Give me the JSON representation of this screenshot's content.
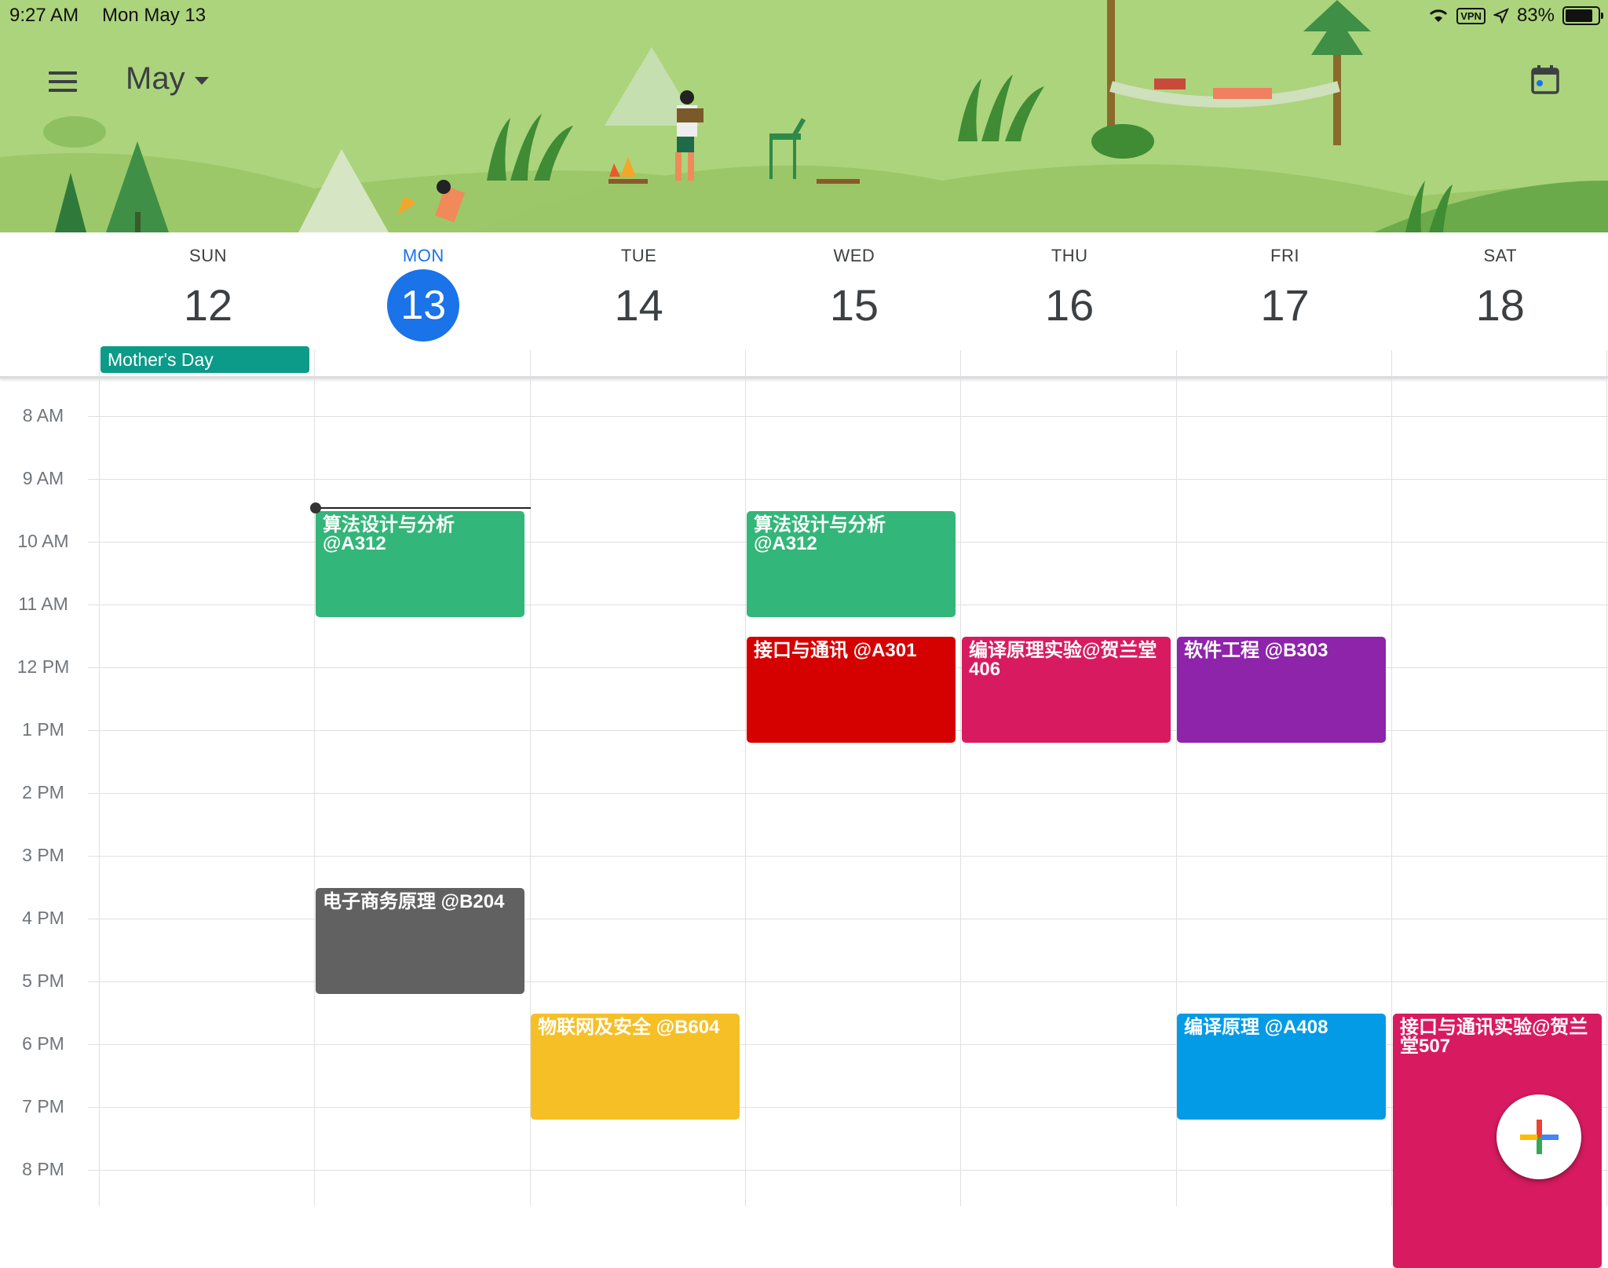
{
  "status_bar": {
    "time": "9:27 AM",
    "date": "Mon May 13",
    "vpn": "VPN",
    "battery": "83%",
    "icons": [
      "wifi-icon",
      "location-arrow-icon",
      "battery-icon"
    ]
  },
  "header": {
    "month": "May",
    "menu_icon": "hamburger-menu-icon",
    "today_icon": "calendar-today-icon"
  },
  "days": [
    {
      "name": "SUN",
      "date": "12",
      "today": false
    },
    {
      "name": "MON",
      "date": "13",
      "today": true
    },
    {
      "name": "TUE",
      "date": "14",
      "today": false
    },
    {
      "name": "WED",
      "date": "15",
      "today": false
    },
    {
      "name": "THU",
      "date": "16",
      "today": false
    },
    {
      "name": "FRI",
      "date": "17",
      "today": false
    },
    {
      "name": "SAT",
      "date": "18",
      "today": false
    }
  ],
  "all_day_events": [
    {
      "title": "Mother's Day",
      "day": "SUN",
      "color": "#0b9b88"
    }
  ],
  "hours": [
    "8 AM",
    "9 AM",
    "10 AM",
    "11 AM",
    "12 PM",
    "1 PM",
    "2 PM",
    "3 PM",
    "4 PM",
    "5 PM",
    "6 PM",
    "7 PM",
    "8 PM"
  ],
  "events": [
    {
      "title": "算法设计与分析 @A312",
      "day": "MON",
      "start": "9:00 AM",
      "end": "10:15 AM",
      "color": "#33b679"
    },
    {
      "title": "算法设计与分析 @A312",
      "day": "WED",
      "start": "9:00 AM",
      "end": "10:15 AM",
      "color": "#33b679"
    },
    {
      "title": "接口与通讯 @A301",
      "day": "WED",
      "start": "11:00 AM",
      "end": "12:15 PM",
      "color": "#d50000"
    },
    {
      "title": "编译原理实验@贺兰堂406",
      "day": "THU",
      "start": "11:00 AM",
      "end": "12:15 PM",
      "color": "#d81b60"
    },
    {
      "title": "软件工程 @B303",
      "day": "FRI",
      "start": "11:00 AM",
      "end": "12:15 PM",
      "color": "#8e24aa"
    },
    {
      "title": "电子商务原理 @B204",
      "day": "MON",
      "start": "3:00 PM",
      "end": "4:15 PM",
      "color": "#616161"
    },
    {
      "title": "物联网及安全 @B604",
      "day": "TUE",
      "start": "5:00 PM",
      "end": "6:15 PM",
      "color": "#f6bf26"
    },
    {
      "title": "编译原理 @A408",
      "day": "FRI",
      "start": "5:00 PM",
      "end": "6:15 PM",
      "color": "#039be5"
    },
    {
      "title": "接口与通讯实验@贺兰堂507",
      "day": "SAT",
      "start": "5:00 PM",
      "end": "8:00 PM",
      "color": "#d81b60"
    }
  ],
  "current_time": "9:27 AM",
  "fab_icon": "add-event-plus-icon",
  "colors": {
    "accent": "#1a73e8",
    "banner": "#acd47c"
  }
}
